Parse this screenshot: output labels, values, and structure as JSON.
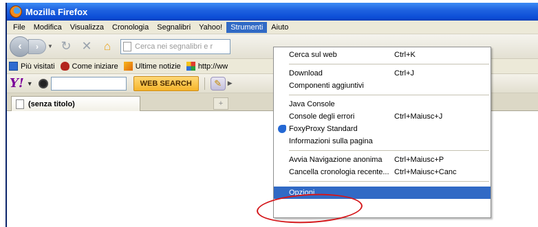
{
  "window": {
    "title": "Mozilla Firefox"
  },
  "menubar": {
    "items": [
      {
        "label": "File"
      },
      {
        "label": "Modifica"
      },
      {
        "label": "Visualizza"
      },
      {
        "label": "Cronologia"
      },
      {
        "label": "Segnalibri"
      },
      {
        "label": "Yahoo!"
      },
      {
        "label": "Strumenti"
      },
      {
        "label": "Aiuto"
      }
    ],
    "active": "Strumenti"
  },
  "navbar": {
    "url_placeholder": "Cerca nei segnalibri e r"
  },
  "bookmarks": [
    {
      "label": "Più visitati"
    },
    {
      "label": "Come iniziare"
    },
    {
      "label": "Ultime notizie"
    },
    {
      "label": "http://ww"
    }
  ],
  "yahoo_toolbar": {
    "logo": "Y!",
    "button": "WEB SEARCH"
  },
  "tab": {
    "title": "(senza titolo)",
    "new_tab": "+"
  },
  "dropdown": {
    "items": [
      {
        "label": "Cerca sul web",
        "shortcut": "Ctrl+K"
      },
      {
        "label": "Download",
        "shortcut": "Ctrl+J"
      },
      {
        "label": "Componenti aggiuntivi",
        "shortcut": ""
      },
      {
        "label": "Java Console",
        "shortcut": ""
      },
      {
        "label": "Console degli errori",
        "shortcut": "Ctrl+Maiusc+J"
      },
      {
        "label": "FoxyProxy Standard",
        "shortcut": ""
      },
      {
        "label": "Informazioni sulla pagina",
        "shortcut": ""
      },
      {
        "label": "Avvia Navigazione anonima",
        "shortcut": "Ctrl+Maiusc+P"
      },
      {
        "label": "Cancella cronologia recente...",
        "shortcut": "Ctrl+Maiusc+Canc"
      },
      {
        "label": "Opzioni...",
        "shortcut": ""
      }
    ],
    "highlighted": "Opzioni..."
  },
  "colors": {
    "titlebar": "#0b4cd6",
    "highlight": "#316ac5",
    "annotation": "#d4161a"
  }
}
